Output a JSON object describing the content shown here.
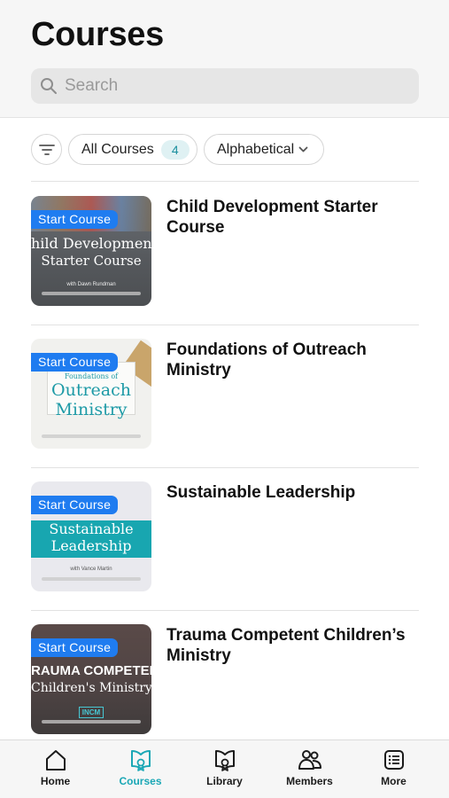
{
  "header": {
    "title": "Courses"
  },
  "search": {
    "placeholder": "Search",
    "icon": "search-icon"
  },
  "filters": {
    "filter_icon": "filter-icon",
    "all_courses_label": "All Courses",
    "count": "4",
    "sort_label": "Alphabetical",
    "sort_icon": "chevron-down-icon"
  },
  "courses": [
    {
      "title": "Child Development Starter Course",
      "badge": "Start Course",
      "thumb_line1": "hild Developmen",
      "thumb_line2": "Starter Course",
      "thumb_small": "with Dawn Rundman"
    },
    {
      "title": "Foundations of Outreach Ministry",
      "badge": "Start Course",
      "thumb_small": "Foundations of",
      "thumb_line1": "Outreach",
      "thumb_line2": "Ministry"
    },
    {
      "title": "Sustainable Leadership",
      "badge": "Start Course",
      "thumb_line1": "Sustainable",
      "thumb_line2": "Leadership",
      "thumb_small": "with Vance Martin"
    },
    {
      "title": "Trauma Competent Children’s Ministry",
      "badge": "Start Course",
      "thumb_line1": "RAUMA COMPETEN",
      "thumb_line2": "Children's Ministry",
      "thumb_small": "INCM"
    }
  ],
  "tabs": [
    {
      "label": "Home",
      "icon": "home-icon"
    },
    {
      "label": "Courses",
      "icon": "courses-icon",
      "active": true
    },
    {
      "label": "Library",
      "icon": "library-icon"
    },
    {
      "label": "Members",
      "icon": "members-icon"
    },
    {
      "label": "More",
      "icon": "more-icon"
    }
  ],
  "colors": {
    "accent": "#1aa7b5",
    "badge": "#1f7cf0",
    "count_bg": "#dff1f3"
  }
}
